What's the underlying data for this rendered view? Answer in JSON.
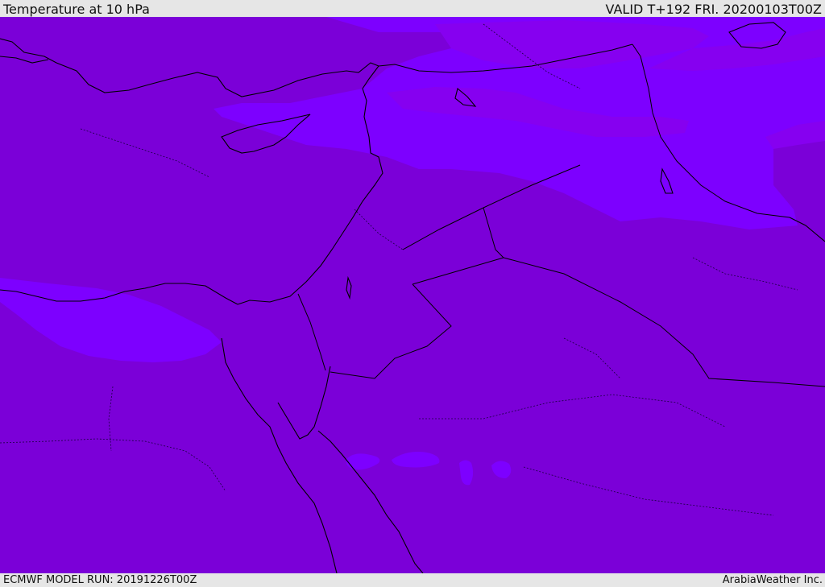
{
  "header": {
    "title": "Temperature at 10 hPa",
    "valid": "VALID T+192 FRI. 20200103T00Z"
  },
  "footer": {
    "model_run": "ECMWF MODEL RUN: 20191226T00Z",
    "credit": "ArabiaWeather Inc."
  },
  "colors": {
    "field_dominant": "#7b00d8",
    "field_warmer_band": "#7f00ff",
    "field_mid_band": "#8400ec",
    "coastline": "#000000"
  },
  "icons": [
    "coastline-lines",
    "border-lines"
  ]
}
